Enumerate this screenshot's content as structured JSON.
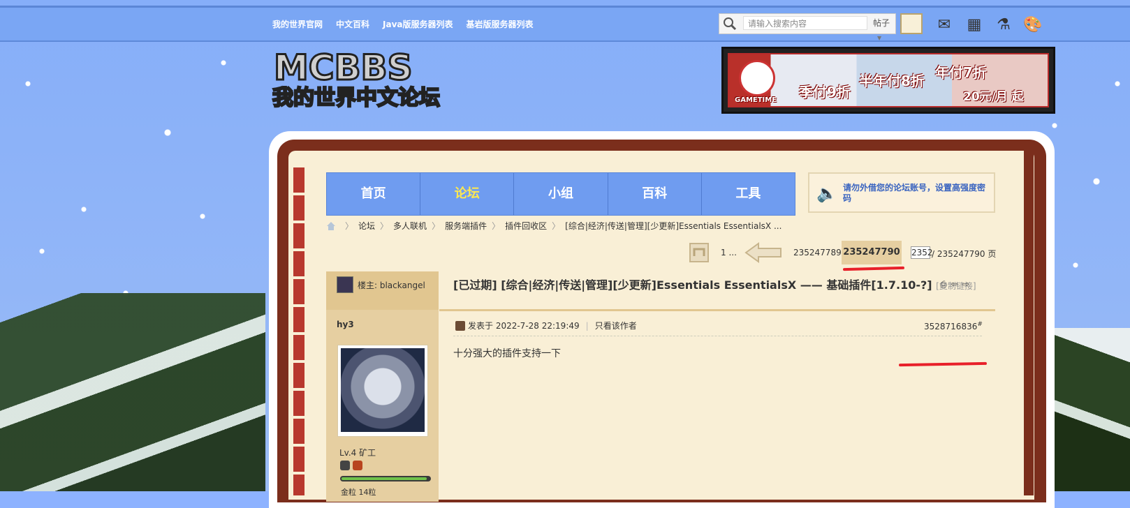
{
  "topbar": {
    "links": [
      "我的世界官网",
      "中文百科",
      "Java版服务器列表",
      "基岩版服务器列表"
    ],
    "search_placeholder": "请输入搜索内容",
    "search_scope": "帖子"
  },
  "logo": {
    "line1": "MCBBS",
    "line2": "我的世界中文论坛"
  },
  "banner": {
    "brand": "GAMETIME",
    "offers": [
      "季付9折",
      "半年付8折",
      "年付7折"
    ],
    "price": "20元/月 起"
  },
  "mainnav": {
    "tabs": [
      "首页",
      "论坛",
      "小组",
      "百科",
      "工具"
    ],
    "active": "论坛"
  },
  "notice": {
    "text": "请勿外借您的论坛账号，设置高强度密码"
  },
  "breadcrumb": [
    "论坛",
    "多人联机",
    "服务端插件",
    "插件回收区",
    "[综合|经济|传送|管理][少更新]Essentials EssentialsX ..."
  ],
  "pager": {
    "first": "1 ...",
    "prev_page": "235247789",
    "current_page": "235247790",
    "input_value": "2352",
    "total_label": "/ 235247790 页"
  },
  "thread": {
    "op_label": "楼主: blackangel",
    "title": "[已过期] [综合|经济|传送|管理][少更新]Essentials EssentialsX —— 基础插件[1.7.10-?]",
    "copy_link": "[复制链接]"
  },
  "post": {
    "author": "hy3",
    "level": "Lv.4 矿工",
    "xp_fraction": 0.97,
    "coins_label": "金粒 14粒",
    "posted": "发表于 2022-7-28 22:19:49",
    "only_author": "只看该作者",
    "floor": "3528716836",
    "floor_mark": "#",
    "content": "十分强大的插件支持一下"
  },
  "colors": {
    "nav_blue": "#6f9cf0",
    "active_yellow": "#ffe94e",
    "annotation_red": "#e8202a"
  }
}
